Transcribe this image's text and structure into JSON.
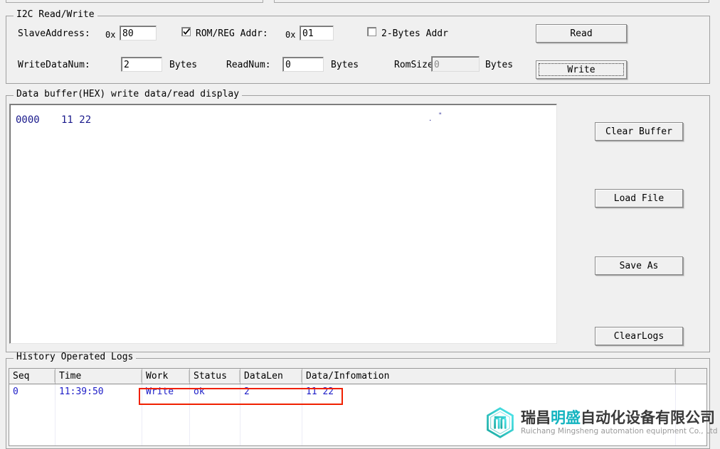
{
  "top_partial_panels": [
    {
      "name": "left-partial-group"
    },
    {
      "name": "right-partial-group"
    }
  ],
  "i2c_group": {
    "title": "I2C Read/Write",
    "slave_address_label": "SlaveAddress:",
    "slave_address_prefix": "0x",
    "slave_address_value": "80",
    "rom_reg_checkbox": {
      "label": "ROM/REG Addr:",
      "checked": true,
      "prefix": "0x",
      "value": "01"
    },
    "two_bytes_addr_checkbox": {
      "label": "2-Bytes Addr",
      "checked": false
    },
    "write_data_num_label": "WriteDataNum:",
    "write_data_num_value": "2",
    "write_data_num_unit": "Bytes",
    "read_num_label": "ReadNum:",
    "read_num_value": "0",
    "read_num_unit": "Bytes",
    "rom_size_label": "RomSize:",
    "rom_size_value": "0",
    "rom_size_unit": "Bytes",
    "rom_size_disabled": true,
    "read_button": "Read",
    "write_button": "Write",
    "write_button_focused": true
  },
  "buffer_group": {
    "title": "Data buffer(HEX) write data/read display",
    "lines": [
      {
        "offset": "0000",
        "hex": "11 22",
        "ascii": ". \""
      }
    ],
    "ascii_col_1": ".",
    "ascii_col_2": "\""
  },
  "side_buttons": [
    {
      "label": "Clear Buffer",
      "name": "clear-buffer-button"
    },
    {
      "label": "Load File",
      "name": "load-file-button"
    },
    {
      "label": "Save As",
      "name": "save-as-button"
    },
    {
      "label": "ClearLogs",
      "name": "clear-logs-button"
    }
  ],
  "logs_group": {
    "title": "History Operated Logs",
    "columns": [
      "Seq",
      "Time",
      "Work",
      "Status",
      "DataLen",
      "Data/Infomation",
      ""
    ],
    "rows": [
      {
        "seq": "0",
        "time": "11:39:50",
        "work": "Write",
        "status": "ok",
        "datalen": "2",
        "data": "11 22"
      }
    ],
    "highlight_color": "#f02000"
  },
  "watermark": {
    "cn_part1": "瑞昌",
    "cn_highlight": "明盛",
    "cn_part2": "自动化设备有限公司",
    "en": "Ruichang Mingsheng automation equipment Co., Ltd",
    "accent_color": "#12b3bf"
  }
}
